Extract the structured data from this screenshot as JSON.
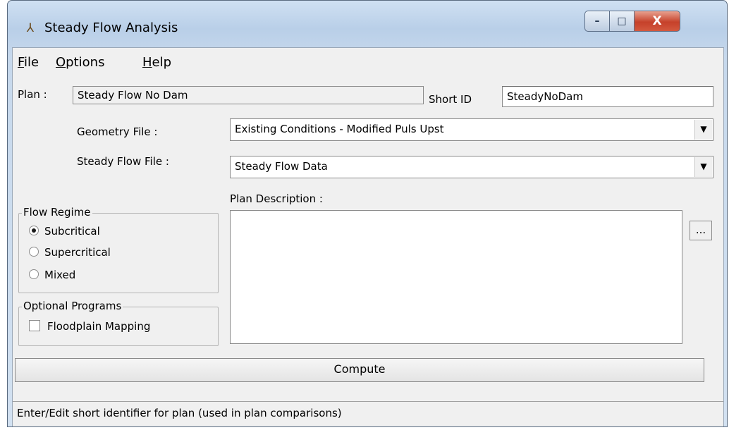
{
  "window": {
    "title": "Steady Flow Analysis",
    "icon": "program-icon",
    "controls": {
      "minimize": "–",
      "maximize": "□",
      "close": "X"
    }
  },
  "menu": [
    {
      "accel": "F",
      "rest": "ile"
    },
    {
      "accel": "O",
      "rest": "ptions"
    },
    {
      "accel": "H",
      "rest": "elp"
    }
  ],
  "plan": {
    "label": "Plan :",
    "value": "Steady Flow No Dam",
    "short_id_label": "Short ID",
    "short_id_value": "SteadyNoDam"
  },
  "geometry": {
    "label": "Geometry File :",
    "selected": "Existing Conditions - Modified Puls Upst"
  },
  "steady_flow": {
    "label": "Steady Flow File :",
    "selected": "Steady Flow Data"
  },
  "plan_description": {
    "label": "Plan Description :",
    "value": "",
    "ellipsis": "..."
  },
  "flow_regime": {
    "title": "Flow Regime",
    "options": [
      "Subcritical",
      "Supercritical",
      "Mixed"
    ],
    "selected": "Subcritical"
  },
  "optional_programs": {
    "title": "Optional Programs",
    "floodplain_mapping": {
      "label": "Floodplain Mapping",
      "checked": false
    }
  },
  "compute_label": "Compute",
  "status_text": "Enter/Edit short identifier for plan (used in plan comparisons)"
}
